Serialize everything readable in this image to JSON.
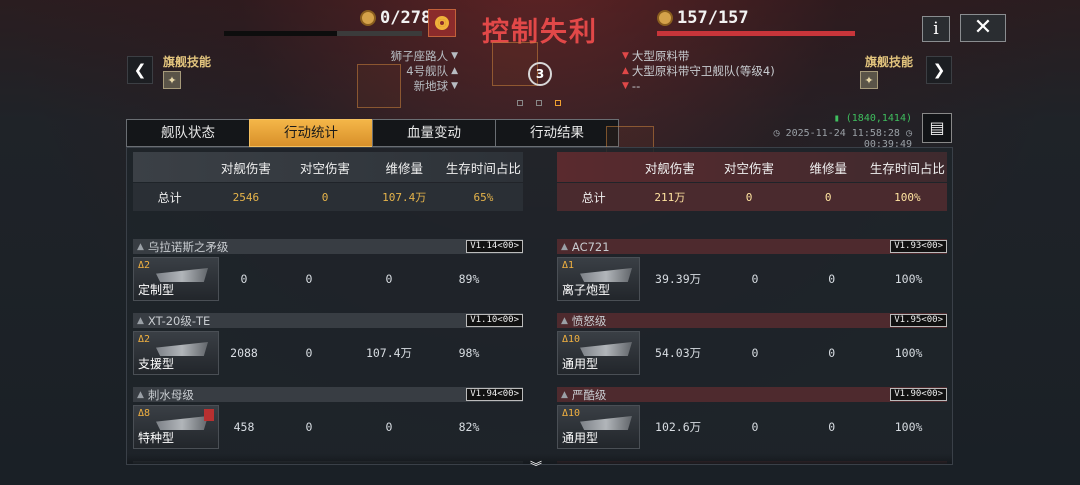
{
  "header": {
    "title": "控制失利",
    "left_resource": "0/278",
    "right_resource": "157/157",
    "left_bar_fraction": 0.57,
    "accent_color": "#e24848"
  },
  "buttons": {
    "info": "i",
    "close": "✕",
    "prev": "❮",
    "next": "❯"
  },
  "flagship": {
    "left_label": "旗舰技能",
    "right_label": "旗舰技能"
  },
  "left_info": [
    "狮子座路人",
    "4号舰队",
    "新地球"
  ],
  "right_info": [
    "大型原料带",
    "大型原料带守卫舰队(等级4)",
    "--"
  ],
  "center_count": "3",
  "tabs": [
    "舰队状态",
    "行动统计",
    "血量变动",
    "行动结果"
  ],
  "active_tab": 1,
  "meta": {
    "coords": "(1840,1414)",
    "datetime": "2025-11-24 11:58:28",
    "duration": "00:39:49"
  },
  "columns": [
    "对舰伤害",
    "对空伤害",
    "维修量",
    "生存时间占比"
  ],
  "left": {
    "total_label": "总计",
    "totals": [
      "2546",
      "0",
      "107.4万",
      "65%"
    ],
    "ships": [
      {
        "name": "乌拉诺斯之矛级",
        "version": "V1.14<00>",
        "level": "Δ2",
        "type": "定制型",
        "stats": [
          "0",
          "0",
          "0",
          "89%"
        ]
      },
      {
        "name": "XT-20级-TE",
        "version": "V1.10<00>",
        "level": "Δ2",
        "type": "支援型",
        "stats": [
          "2088",
          "0",
          "107.4万",
          "98%"
        ]
      },
      {
        "name": "刺水母级",
        "version": "V1.94<00>",
        "level": "Δ8",
        "type": "特种型",
        "stats": [
          "458",
          "0",
          "0",
          "82%"
        ]
      }
    ]
  },
  "right": {
    "total_label": "总计",
    "totals": [
      "211万",
      "0",
      "0",
      "100%"
    ],
    "ships": [
      {
        "name": "AC721",
        "version": "V1.93<00>",
        "level": "Δ1",
        "type": "离子炮型",
        "stats": [
          "39.39万",
          "0",
          "0",
          "100%"
        ]
      },
      {
        "name": "愤怒级",
        "version": "V1.95<00>",
        "level": "Δ10",
        "type": "通用型",
        "stats": [
          "54.03万",
          "0",
          "0",
          "100%"
        ]
      },
      {
        "name": "严酷级",
        "version": "V1.90<00>",
        "level": "Δ10",
        "type": "通用型",
        "stats": [
          "102.6万",
          "0",
          "0",
          "100%"
        ]
      }
    ]
  }
}
